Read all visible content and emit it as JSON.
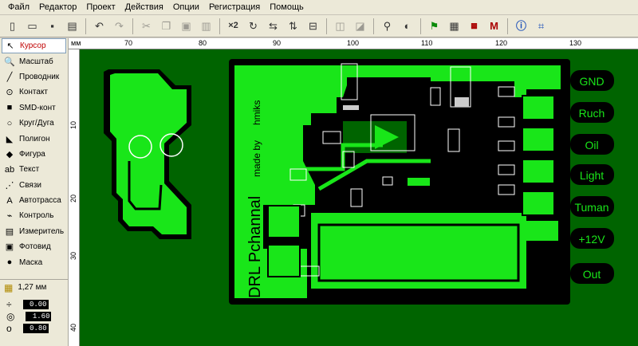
{
  "menu": [
    "Файл",
    "Редактор",
    "Проект",
    "Действия",
    "Опции",
    "Регистрация",
    "Помощь"
  ],
  "toolbar": {
    "multiplier_label": "×2",
    "icons": [
      "new-icon",
      "open-icon",
      "save-icon",
      "print-icon",
      "undo-icon",
      "redo-icon",
      "cut-icon",
      "copy-icon",
      "paste-icon",
      "delete-icon",
      "duplicate-icon",
      "rotate-icon",
      "mirror-horizontal-icon",
      "mirror-vertical-icon",
      "align-icon",
      "group-icon",
      "ungroup-icon",
      "magnifier-icon",
      "contrast-icon",
      "autoroute-icon",
      "photoview-icon",
      "drc-icon",
      "macro-icon",
      "help-icon",
      "crop-icon"
    ]
  },
  "tools": [
    {
      "id": "cursor",
      "label": "Курсор",
      "icon": "cursor-icon",
      "glyph": "↖",
      "active": true
    },
    {
      "id": "zoom",
      "label": "Масштаб",
      "icon": "zoom-icon",
      "glyph": "🔍",
      "active": false
    },
    {
      "id": "wire",
      "label": "Проводник",
      "icon": "wire-icon",
      "glyph": "╱",
      "active": false
    },
    {
      "id": "pad",
      "label": "Контакт",
      "icon": "pad-icon",
      "glyph": "⊙",
      "active": false
    },
    {
      "id": "smd",
      "label": "SMD-конт",
      "icon": "smd-pad-icon",
      "glyph": "■",
      "active": false
    },
    {
      "id": "arc",
      "label": "Круг/Дуга",
      "icon": "circle-icon",
      "glyph": "○",
      "active": false
    },
    {
      "id": "polygon",
      "label": "Полигон",
      "icon": "polygon-icon",
      "glyph": "◣",
      "active": false
    },
    {
      "id": "shape",
      "label": "Фигура",
      "icon": "shape-icon",
      "glyph": "◆",
      "active": false
    },
    {
      "id": "text",
      "label": "Текст",
      "icon": "text-icon",
      "glyph": "ab",
      "active": false
    },
    {
      "id": "connect",
      "label": "Связи",
      "icon": "connections-icon",
      "glyph": "⋰",
      "active": false
    },
    {
      "id": "autoroute",
      "label": "Автотрасса",
      "icon": "autoroute-tool-icon",
      "glyph": "A",
      "active": false
    },
    {
      "id": "control",
      "label": "Контроль",
      "icon": "control-icon",
      "glyph": "⌁",
      "active": false
    },
    {
      "id": "measure",
      "label": "Измеритель",
      "icon": "ruler-icon",
      "glyph": "▤",
      "active": false
    },
    {
      "id": "photo",
      "label": "Фотовид",
      "icon": "photo-icon",
      "glyph": "▣",
      "active": false
    },
    {
      "id": "mask",
      "label": "Маска",
      "icon": "mask-icon",
      "glyph": "●",
      "active": false
    }
  ],
  "grid": {
    "label": "1,27 мм"
  },
  "params": [
    {
      "icon": "track-width-icon",
      "glyph": "÷",
      "value": "0.00"
    },
    {
      "icon": "pad-outer-icon",
      "glyph": "◎",
      "value": "1.60"
    },
    {
      "icon": "pad-inner-icon",
      "glyph": "o",
      "value": "0.80"
    }
  ],
  "ruler": {
    "unit": "мм",
    "x_labels": [
      "70",
      "80",
      "90",
      "100",
      "110",
      "120",
      "130"
    ],
    "y_labels": [
      "10",
      "20",
      "30",
      "40"
    ]
  },
  "board": {
    "labels_right": [
      "GND",
      "Ruch",
      "Oil",
      "Light",
      "Tuman",
      "+12V",
      "Out"
    ],
    "text_big": "DRL Pchannal",
    "text_small_1": "made by",
    "text_small_2": "hmiks",
    "colors": {
      "background": "#006400",
      "copper": "#19e619",
      "gap": "#000000",
      "silk": "#ffffff"
    }
  }
}
